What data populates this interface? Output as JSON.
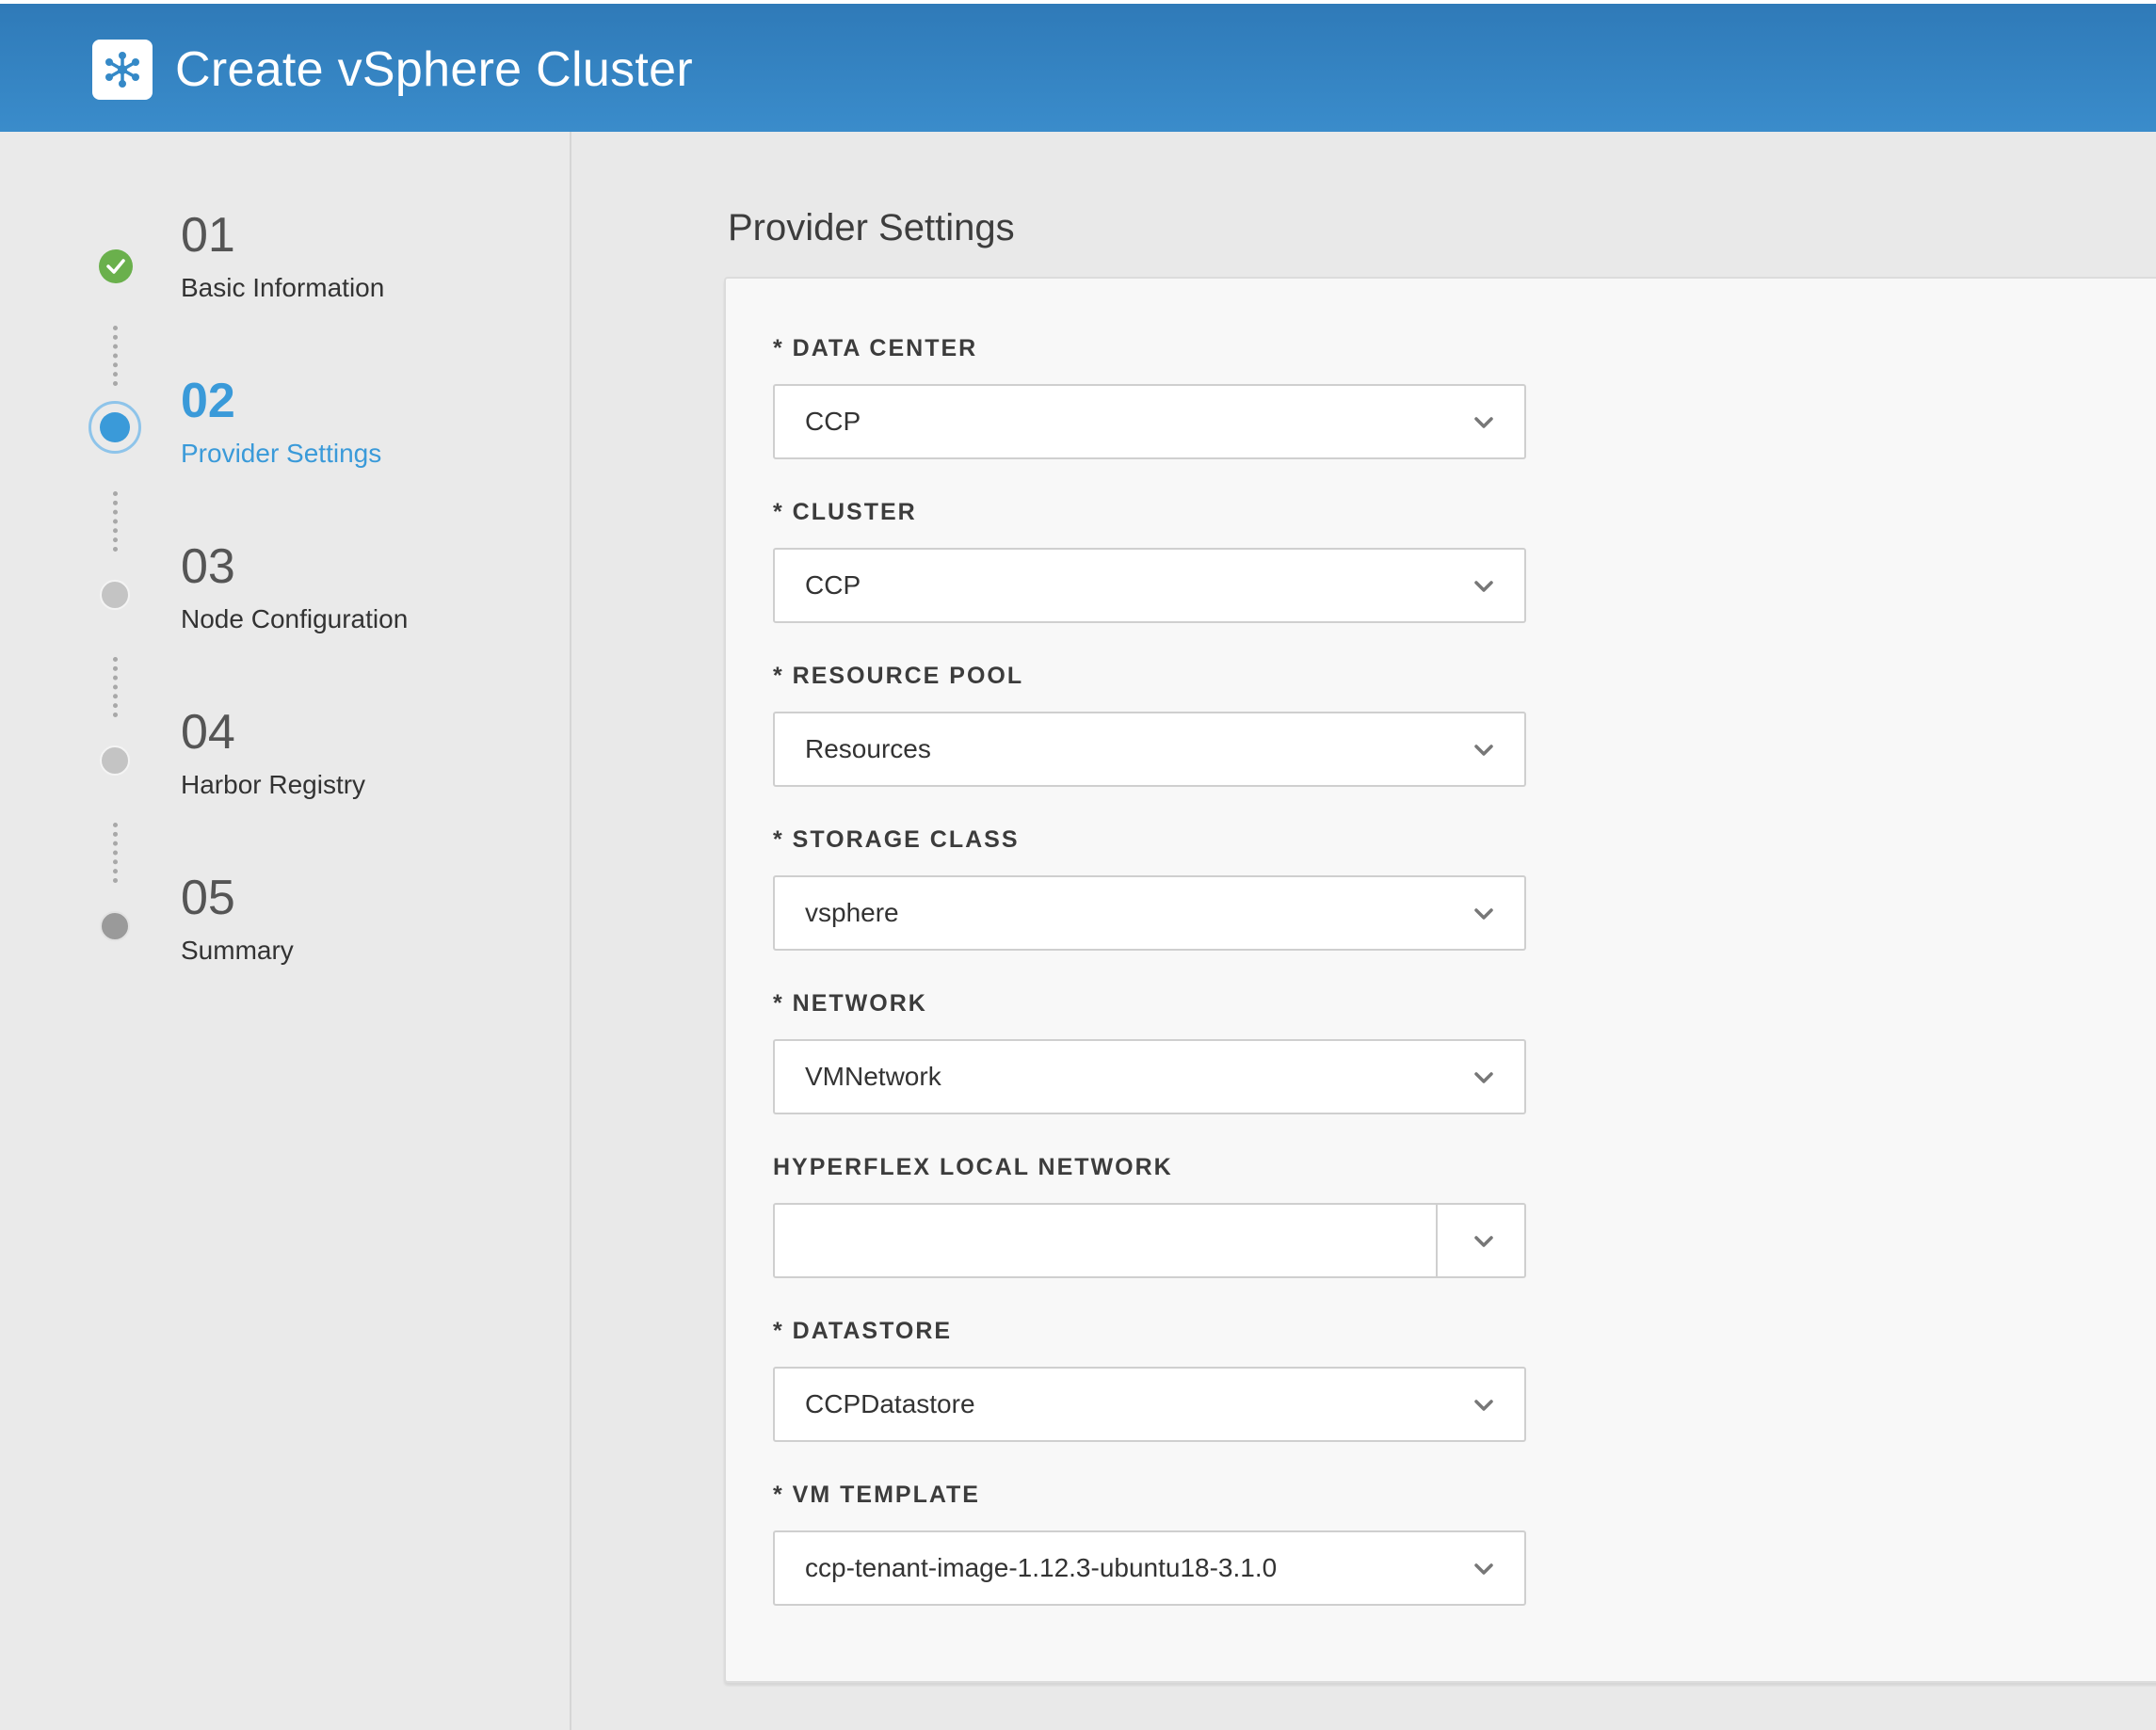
{
  "header": {
    "title": "Create vSphere Cluster",
    "logo_icon": "network-hub-icon",
    "bg_color": "#3589c7"
  },
  "wizard": {
    "steps": [
      {
        "number": "01",
        "label": "Basic Information",
        "status": "completed"
      },
      {
        "number": "02",
        "label": "Provider Settings",
        "status": "active"
      },
      {
        "number": "03",
        "label": "Node Configuration",
        "status": "pending"
      },
      {
        "number": "04",
        "label": "Harbor Registry",
        "status": "pending"
      },
      {
        "number": "05",
        "label": "Summary",
        "status": "pending"
      }
    ],
    "active_color": "#3a9ad9",
    "completed_color": "#6ab04c"
  },
  "form": {
    "title": "Provider Settings",
    "fields": [
      {
        "label": "* DATA CENTER",
        "value": "CCP"
      },
      {
        "label": "* CLUSTER",
        "value": "CCP"
      },
      {
        "label": "* RESOURCE POOL",
        "value": "Resources"
      },
      {
        "label": "* STORAGE CLASS",
        "value": "vsphere"
      },
      {
        "label": "* NETWORK",
        "value": "VMNetwork"
      },
      {
        "label": "HYPERFLEX LOCAL NETWORK",
        "value": ""
      },
      {
        "label": "* DATASTORE",
        "value": "CCPDatastore"
      },
      {
        "label": "* VM TEMPLATE",
        "value": "ccp-tenant-image-1.12.3-ubuntu18-3.1.0"
      }
    ]
  }
}
